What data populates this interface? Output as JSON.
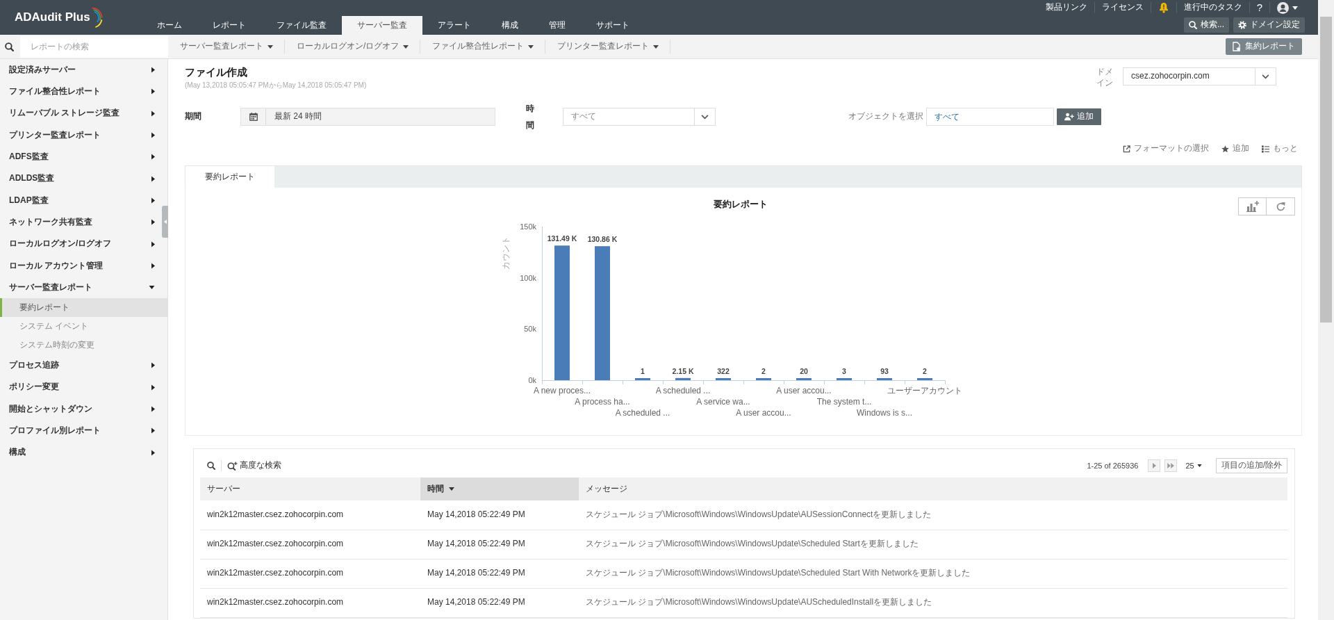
{
  "header": {
    "logo": "ADAudit Plus",
    "nav_tabs": [
      {
        "label": "ホーム",
        "selected": false
      },
      {
        "label": "レポート",
        "selected": false
      },
      {
        "label": "ファイル監査",
        "selected": false
      },
      {
        "label": "サーバー監査",
        "selected": true
      },
      {
        "label": "アラート",
        "selected": false
      },
      {
        "label": "構成",
        "selected": false
      },
      {
        "label": "管理",
        "selected": false
      },
      {
        "label": "サポート",
        "selected": false
      }
    ],
    "top_links": [
      {
        "kind": "link",
        "label": "製品リンク"
      },
      {
        "kind": "link",
        "label": "ライセンス"
      },
      {
        "kind": "alerts"
      },
      {
        "kind": "link",
        "label": "進行中のタスク"
      },
      {
        "kind": "help",
        "label": "?"
      },
      {
        "kind": "account"
      }
    ],
    "buttons": [
      {
        "kind": "search",
        "label": "検索..."
      },
      {
        "kind": "settings",
        "label": "ドメイン設定"
      }
    ]
  },
  "toolbar": {
    "report_search": {
      "placeholder": "レポートの検索"
    },
    "menus": [
      "サーバー監査レポート",
      "ローカルログオン/ログオフ",
      "ファイル整合性レポート",
      "プリンター監査レポート"
    ],
    "consolidated_report": "集約レポート"
  },
  "sidebar": {
    "items": [
      {
        "label": "設定済みサーバー",
        "expanded": false
      },
      {
        "label": "ファイル整合性レポート",
        "expanded": false
      },
      {
        "label": "リムーバブル ストレージ監査",
        "expanded": false
      },
      {
        "label": "プリンター監査レポート",
        "expanded": false
      },
      {
        "label": "ADFS監査",
        "expanded": false
      },
      {
        "label": "ADLDS監査",
        "expanded": false
      },
      {
        "label": "LDAP監査",
        "expanded": false
      },
      {
        "label": "ネットワーク共有監査",
        "expanded": false
      },
      {
        "label": "ローカルログオン/ログオフ",
        "expanded": false
      },
      {
        "label": "ローカル アカウント管理",
        "expanded": false
      },
      {
        "label": "サーバー監査レポート",
        "expanded": true,
        "children": [
          {
            "label": "要約レポート",
            "selected": true
          },
          {
            "label": "システム イベント",
            "selected": false
          },
          {
            "label": "システム時刻の変更",
            "selected": false
          }
        ]
      },
      {
        "label": "プロセス追跡",
        "expanded": false
      },
      {
        "label": "ポリシー変更",
        "expanded": false
      },
      {
        "label": "開始とシャットダウン",
        "expanded": false
      },
      {
        "label": "プロファイル別レポート",
        "expanded": false
      },
      {
        "label": "構成",
        "expanded": false
      }
    ]
  },
  "report": {
    "title": "ファイル作成",
    "period": "(May 13,2018 05:05:47 PMからMay 14,2018 05:05:47 PM)",
    "domain": {
      "label": "ドメイン",
      "value": "csez.zohocorpin.com"
    },
    "filters": {
      "period": {
        "label": "期間",
        "value": "最新 24 時間"
      },
      "time": {
        "label": "時間",
        "value": "すべて"
      },
      "object": {
        "label": "オブジェクトを選択",
        "value": "すべて"
      },
      "add_button": "追加"
    },
    "actions": [
      {
        "kind": "export",
        "label": "フォーマットの選択"
      },
      {
        "kind": "favorite",
        "label": "追加"
      },
      {
        "kind": "more",
        "label": "もっと"
      }
    ],
    "tabs": [
      {
        "label": "要約レポート",
        "selected": true
      }
    ],
    "summary": {
      "chart_data": {
        "type": "bar",
        "title": "要約レポート",
        "ylabel": "カウント",
        "categories": [
          "A new proces...",
          "A process ha...",
          "A scheduled ...",
          "A scheduled ...",
          "A service wa...",
          "A user accou...",
          "A user accou...",
          "The system t...",
          "Windows is s...",
          "ユーザーアカウント"
        ],
        "series": [
          {
            "color": "#4a7db8",
            "values": [
              131490,
              130860,
              1,
              2150,
              322,
              2,
              20,
              3,
              93,
              2
            ]
          }
        ],
        "ylim": [
          0,
          150000
        ],
        "yticks": [
          {
            "value": 0,
            "label": "0k"
          },
          {
            "value": 50000,
            "label": "50k"
          },
          {
            "value": 100000,
            "label": "100k"
          },
          {
            "value": 150000,
            "label": "150k"
          }
        ],
        "value_labels": [
          "131.49 K",
          "130.86 K",
          "1",
          "2.15 K",
          "322",
          "2",
          "20",
          "3",
          "93",
          "2"
        ]
      }
    },
    "table": {
      "advanced_search": "高度な検索",
      "pagination": "1-25 of 265936",
      "page_size": "25",
      "columns_button": "項目の追加/除外",
      "columns": [
        {
          "label": "サーバー",
          "sorted": false
        },
        {
          "label": "時間",
          "sorted": true
        },
        {
          "label": "メッセージ",
          "sorted": false
        }
      ],
      "rows": [
        [
          "win2k12master.csez.zohocorpin.com",
          "May 14,2018 05:22:49 PM",
          "スケジュール ジョブ\\Microsoft\\Windows\\WindowsUpdate\\AUSessionConnectを更新しました"
        ],
        [
          "win2k12master.csez.zohocorpin.com",
          "May 14,2018 05:22:49 PM",
          "スケジュール ジョブ\\Microsoft\\Windows\\WindowsUpdate\\Scheduled Startを更新しました"
        ],
        [
          "win2k12master.csez.zohocorpin.com",
          "May 14,2018 05:22:49 PM",
          "スケジュール ジョブ\\Microsoft\\Windows\\WindowsUpdate\\Scheduled Start With Networkを更新しました"
        ],
        [
          "win2k12master.csez.zohocorpin.com",
          "May 14,2018 05:22:49 PM",
          "スケジュール ジョブ\\Microsoft\\Windows\\WindowsUpdate\\AUScheduledInstallを更新しました"
        ]
      ]
    }
  }
}
